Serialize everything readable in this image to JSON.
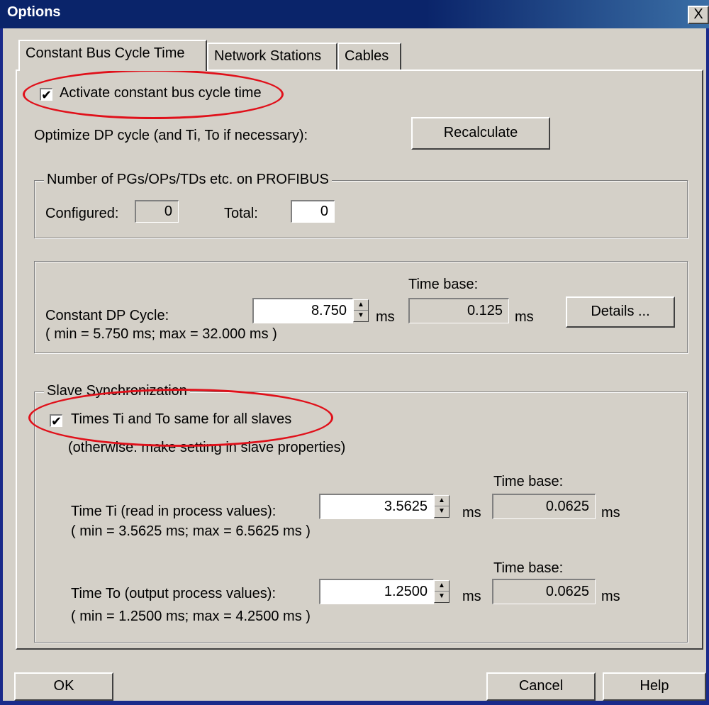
{
  "window": {
    "title": "Options",
    "close_glyph": "X"
  },
  "tabs": [
    {
      "label": "Constant Bus Cycle Time"
    },
    {
      "label": "Network Stations"
    },
    {
      "label": "Cables"
    }
  ],
  "activate": {
    "label": "Activate constant bus cycle time",
    "checked": true
  },
  "optimize": {
    "label": "Optimize DP cycle (and Ti, To if necessary):",
    "recalculate_label": "Recalculate"
  },
  "pgs_group": {
    "legend": "Number of PGs/OPs/TDs etc. on PROFIBUS",
    "configured_label": "Configured:",
    "configured_value": "0",
    "total_label": "Total:",
    "total_value": "0"
  },
  "dp_cycle": {
    "label": "Constant DP Cycle:",
    "value": "8.750",
    "unit": "ms",
    "range": "( min = 5.750 ms;   max = 32.000 ms )",
    "timebase_label": "Time base:",
    "timebase_value": "0.125",
    "timebase_unit": "ms",
    "details_label": "Details ..."
  },
  "slave_sync": {
    "legend": "Slave Synchronization",
    "same_label": "Times Ti and To same for all slaves",
    "same_checked": true,
    "note": "(otherwise: make setting in slave properties)",
    "ti": {
      "label": "Time Ti (read in process values):",
      "value": "3.5625",
      "unit": "ms",
      "range": "( min = 3.5625 ms;   max = 6.5625 ms )",
      "timebase_label": "Time base:",
      "timebase_value": "0.0625",
      "timebase_unit": "ms"
    },
    "to": {
      "label": "Time To (output process values):",
      "value": "1.2500",
      "unit": "ms",
      "range": "( min = 1.2500 ms;   max = 4.2500 ms )",
      "timebase_label": "Time base:",
      "timebase_value": "0.0625",
      "timebase_unit": "ms"
    }
  },
  "footer": {
    "ok_label": "OK",
    "cancel_label": "Cancel",
    "help_label": "Help"
  },
  "icons": {
    "check": "check-icon",
    "spin_up": "up-arrow-icon",
    "spin_down": "down-arrow-icon",
    "close": "close-icon"
  },
  "colors": {
    "titlebar": "#0a246a",
    "highlight_ellipse": "#e0101a",
    "dialog_bg": "#d4d0c8"
  }
}
